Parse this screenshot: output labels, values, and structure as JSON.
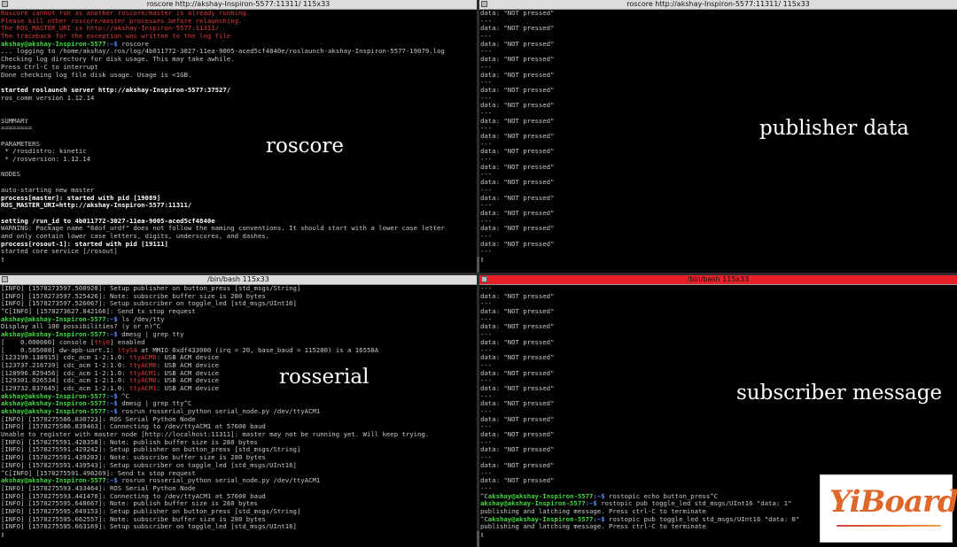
{
  "panes": {
    "top_left": {
      "title": "roscore http://akshay-Inspiron-5577:11311/ 115x33",
      "label": "roscore",
      "lines": [
        {
          "t": "Roscore cannot run as another roscore/master is already running.",
          "c": "c-red"
        },
        {
          "t": "Please kill other roscore/master processes before relaunching.",
          "c": "c-red"
        },
        {
          "t": "The ROS_MASTER_URI is http://akshay-Inspiron-5577:11311/",
          "c": "c-red"
        },
        {
          "t": "The traceback for the exception was written to the log file",
          "c": "c-red"
        },
        {
          "prompt": true,
          "user": "akshay@akshay-Inspiron-5577",
          "path": ":~$",
          "cmd": " roscore"
        },
        {
          "t": "... logging to /home/akshay/.ros/log/4b011772-3027-11ea-9005-aced5cf4840e/roslaunch-akshay-Inspiron-5577-19079.log"
        },
        {
          "t": "Checking log directory for disk usage. This may take awhile."
        },
        {
          "t": "Press Ctrl-C to interrupt"
        },
        {
          "t": "Done checking log file disk usage. Usage is <1GB."
        },
        {
          "t": ""
        },
        {
          "t": "started roslaunch server http://akshay-Inspiron-5577:37527/",
          "c": "c-bold"
        },
        {
          "t": "ros_comm version 1.12.14"
        },
        {
          "t": ""
        },
        {
          "t": ""
        },
        {
          "t": "SUMMARY"
        },
        {
          "t": "========"
        },
        {
          "t": ""
        },
        {
          "t": "PARAMETERS"
        },
        {
          "t": " * /rosdistro: kinetic"
        },
        {
          "t": " * /rosversion: 1.12.14"
        },
        {
          "t": ""
        },
        {
          "t": "NODES"
        },
        {
          "t": ""
        },
        {
          "t": "auto-starting new master"
        },
        {
          "t": "process[master]: started with pid [19089]",
          "c": "c-bold"
        },
        {
          "t": "ROS_MASTER_URI=http://akshay-Inspiron-5577:11311/",
          "c": "c-bold"
        },
        {
          "t": ""
        },
        {
          "t": "setting /run_id to 4b011772-3027-11ea-9005-aced5cf4840e",
          "c": "c-bold"
        },
        {
          "t": "WARNING: Package name \"6dof_urdf\" does not follow the naming conventions. It should start with a lower case letter"
        },
        {
          "t": "and only contain lower case letters, digits, underscores, and dashes."
        },
        {
          "t": "process[rosout-1]: started with pid [19111]",
          "c": "c-bold"
        },
        {
          "t": "started core service [/rosout]"
        },
        {
          "t": "▯",
          "c": "c-cursor"
        }
      ]
    },
    "top_right": {
      "title": "roscore http://akshay-Inspiron-5577:11311/ 115x33",
      "label": "publisher  data",
      "lines": [
        {
          "t": "data: \"NOT pressed\""
        },
        {
          "t": "---"
        },
        {
          "t": "data: \"NOT pressed\""
        },
        {
          "t": "---"
        },
        {
          "t": "data: \"NOT pressed\""
        },
        {
          "t": "---"
        },
        {
          "t": "data: \"NOT pressed\""
        },
        {
          "t": "---"
        },
        {
          "t": "data: \"NOT pressed\""
        },
        {
          "t": "---"
        },
        {
          "t": "data: \"NOT pressed\""
        },
        {
          "t": "---"
        },
        {
          "t": "data: \"NOT pressed\""
        },
        {
          "t": "---"
        },
        {
          "t": "data: \"NOT pressed\""
        },
        {
          "t": "---"
        },
        {
          "t": "data: \"NOT pressed\""
        },
        {
          "t": "---"
        },
        {
          "t": "data: \"NOT pressed\""
        },
        {
          "t": "---"
        },
        {
          "t": "data: \"NOT pressed\""
        },
        {
          "t": "---"
        },
        {
          "t": "data: \"NOT pressed\""
        },
        {
          "t": "---"
        },
        {
          "t": "data: \"NOT pressed\""
        },
        {
          "t": "---"
        },
        {
          "t": "data: \"NOT pressed\""
        },
        {
          "t": "---"
        },
        {
          "t": "data: \"NOT pressed\""
        },
        {
          "t": "---"
        },
        {
          "t": "data: \"NOT pressed\""
        },
        {
          "t": "---"
        },
        {
          "t": "▯",
          "c": "c-cursor"
        }
      ]
    },
    "bottom_left": {
      "title": "/bin/bash 115x33",
      "label": "rosserial",
      "lines": [
        {
          "t": "[INFO] [1578273597.508920]: Setup publisher on button_press [std_msgs/String]"
        },
        {
          "t": "[INFO] [1578273597.525426]: Note: subscribe buffer size is 280 bytes"
        },
        {
          "t": "[INFO] [1578273597.526067]: Setup subscriber on toggle_led [std_msgs/UInt16]"
        },
        {
          "t": "^C[INFO] [1578273627.842166]: Send tx stop request"
        },
        {
          "prompt": true,
          "user": "akshay@akshay-Inspiron-5577",
          "path": ":~$",
          "cmd": " ls /dev/tty"
        },
        {
          "t": "Display all 100 possibilities? (y or n)^C"
        },
        {
          "prompt": true,
          "user": "akshay@akshay-Inspiron-5577",
          "path": ":~$",
          "cmd": " dmesg | grep tty"
        },
        {
          "t": "[    0.000000] console [",
          "hl": "tty0",
          "t2": "] enabled"
        },
        {
          "t": "[    0.585008] dw-apb-uart.1: ",
          "hl": "ttyS4",
          "t2": " at MMIO 0xdf433000 (irq = 20, base_baud = 115200) is a 16550A"
        },
        {
          "t": "[123199.138915] cdc_acm 1-2:1.0: ",
          "hl": "ttyACM0",
          "t2": ": USB ACM device"
        },
        {
          "t": "[123737.216739] cdc_acm 1-2:1.0: ",
          "hl": "ttyACM0",
          "t2": ": USB ACM device"
        },
        {
          "t": "[128996.829456] cdc_acm 1-2:1.0: ",
          "hl": "ttyACM1",
          "t2": ": USB ACM device"
        },
        {
          "t": "[129301.026534] cdc_acm 1-2:1.0: ",
          "hl": "ttyACM0",
          "t2": ": USB ACM device"
        },
        {
          "t": "[129732.837645] cdc_acm 1-2:1.0: ",
          "hl": "ttyACM1",
          "t2": ": USB ACM device"
        },
        {
          "prompt": true,
          "user": "akshay@akshay-Inspiron-5577",
          "path": ":~$",
          "cmd": " ^C"
        },
        {
          "prompt": true,
          "user": "akshay@akshay-Inspiron-5577",
          "path": ":~$",
          "cmd": " dmesg | grep tty^C"
        },
        {
          "prompt": true,
          "user": "akshay@akshay-Inspiron-5577",
          "path": ":~$",
          "cmd": " rosrun rosserial_python serial_node.py /dev/ttyACM1"
        },
        {
          "t": "[INFO] [1578275586.830723]: ROS Serial Python Node"
        },
        {
          "t": "[INFO] [1578275586.839463]: Connecting to /dev/ttyACM1 at 57600 baud"
        },
        {
          "t": "Unable to register with master node [http://localhost:11311]: master may not be running yet. Will keep trying."
        },
        {
          "t": "[INFO] [1578275591.428358]: Note: publish buffer size is 280 bytes"
        },
        {
          "t": "[INFO] [1578275591.429242]: Setup publisher on button_press [std_msgs/String]"
        },
        {
          "t": "[INFO] [1578275591.439203]: Note: subscribe buffer size is 280 bytes"
        },
        {
          "t": "[INFO] [1578275591.439543]: Setup subscriber on toggle_led [std_msgs/UInt16]"
        },
        {
          "t": "^C[INFO] [1578275591.498269]: Send tx stop request"
        },
        {
          "prompt": true,
          "user": "akshay@akshay-Inspiron-5577",
          "path": ":~$",
          "cmd": " rosrun rosserial_python serial_node.py /dev/ttyACM1"
        },
        {
          "t": "[INFO] [1578275593.433464]: ROS Serial Python Node"
        },
        {
          "t": "[INFO] [1578275593.441476]: Connecting to /dev/ttyACM1 at 57600 baud"
        },
        {
          "t": "[INFO] [1578275595.648667]: Note: publish buffer size is 280 bytes"
        },
        {
          "t": "[INFO] [1578275595.649153]: Setup publisher on button_press [std_msgs/String]"
        },
        {
          "t": "[INFO] [1578275595.662557]: Note: subscribe buffer size is 280 bytes"
        },
        {
          "t": "[INFO] [1578275595.663169]: Setup subscriber on toggle_led [std_msgs/UInt16]"
        },
        {
          "t": "▯",
          "c": "c-cursor"
        }
      ]
    },
    "bottom_right": {
      "title": "/bin/bash 115x33",
      "label": "subscriber  message",
      "lines": [
        {
          "t": "---"
        },
        {
          "t": "data: \"NOT pressed\""
        },
        {
          "t": "---"
        },
        {
          "t": "data: \"NOT pressed\""
        },
        {
          "t": "---"
        },
        {
          "t": "data: \"NOT pressed\""
        },
        {
          "t": "---"
        },
        {
          "t": "data: \"NOT pressed\""
        },
        {
          "t": "---"
        },
        {
          "t": "data: \"NOT pressed\""
        },
        {
          "t": "---"
        },
        {
          "t": "data: \"NOT pressed\""
        },
        {
          "t": "---"
        },
        {
          "t": "data: \"NOT pressed\""
        },
        {
          "t": "---"
        },
        {
          "t": "data: \"NOT pressed\""
        },
        {
          "t": "---"
        },
        {
          "t": "data: \"NOT pressed\""
        },
        {
          "t": "---"
        },
        {
          "t": "data: \"NOT pressed\""
        },
        {
          "t": "---"
        },
        {
          "t": "data: \"NOT pressed\""
        },
        {
          "t": "---"
        },
        {
          "t": "data: \"NOT pressed\""
        },
        {
          "t": "---"
        },
        {
          "t": "data: \"NOT pressed\""
        },
        {
          "t": "---"
        },
        {
          "t": "^C",
          "pre": true,
          "prompt": true,
          "user": "akshay@akshay-Inspiron-5577",
          "path": ":~$",
          "cmd": " rostopic echo button_press^C"
        },
        {
          "prompt": true,
          "user": "akshay@akshay-Inspiron-5577",
          "path": ":~$",
          "cmd": " rostopic pub toggle_led std_msgs/UInt16 \"data: 1\""
        },
        {
          "t": "publishing and latching message. Press ctrl-C to terminate"
        },
        {
          "t": "^C",
          "pre": true,
          "prompt": true,
          "user": "akshay@akshay-Inspiron-5577",
          "path": ":~$",
          "cmd": " rostopic pub toggle_led std_msgs/UInt16 \"data: 0\""
        },
        {
          "t": "publishing and latching message. Press ctrl-C to terminate"
        },
        {
          "t": "▯",
          "c": "c-cursor"
        }
      ]
    }
  },
  "logo": {
    "brand_a": "Yi",
    "brand_b": "Board"
  },
  "colors": {
    "user_prompt": "#41d941",
    "path_prompt": "#5c8cff",
    "error_text": "#e23a3a",
    "active_titlebar": "#e8202a"
  }
}
